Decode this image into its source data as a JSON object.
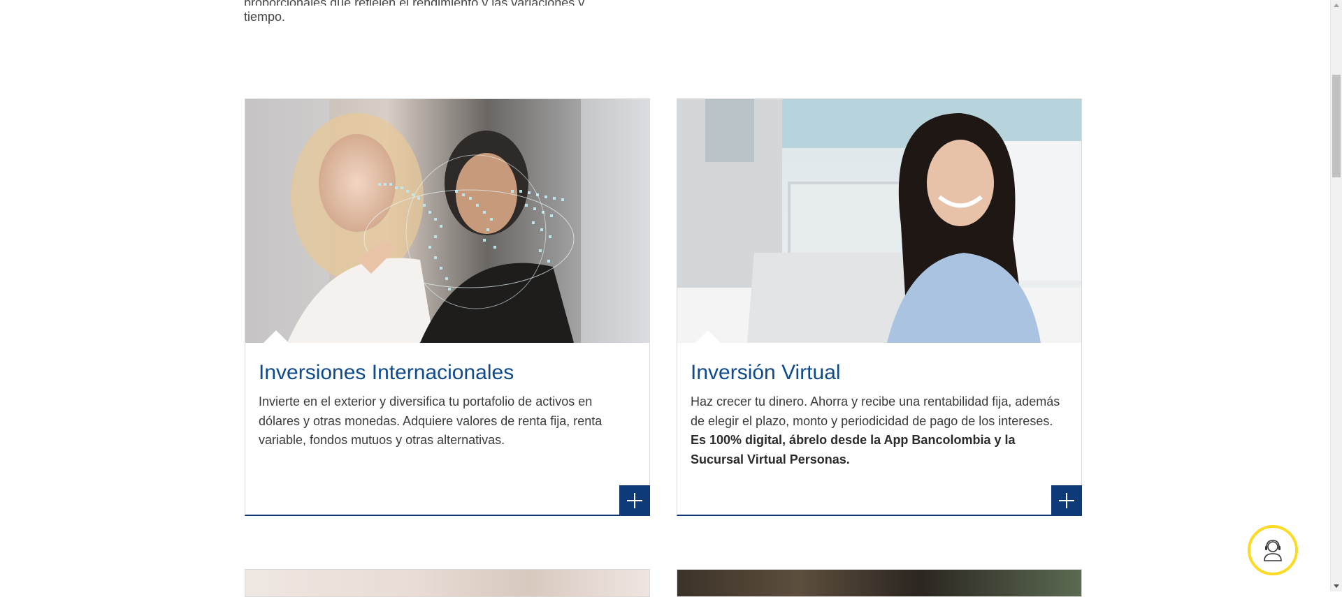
{
  "intro": {
    "cut_line": "proporcionales que reflejen el rendimiento y las variaciones y",
    "tail_word": "tiempo."
  },
  "cards": [
    {
      "title": "Inversiones Internacionales",
      "description": "Invierte en el exterior y diversifica tu portafolio de activos en dólares y otras monedas. Adquiere valores de renta fija, renta variable, fondos mutuos  y otras alternativas.",
      "photo_icon": "world-map-touch-photo",
      "more_icon": "plus-icon"
    },
    {
      "title": "Inversión Virtual",
      "description_plain": "Haz crecer tu dinero. Ahorra y recibe una rentabilidad fija, además de elegir el plazo, monto y periodicidad de pago de los intereses. ",
      "description_bold": "Es 100% digital, ábrelo desde la App Bancolombia y la Sucursal Virtual Personas.",
      "photo_icon": "woman-laptop-photo",
      "more_icon": "plus-icon"
    }
  ],
  "chat": {
    "icon": "support-agent-icon",
    "accent": "#fdda24"
  },
  "colors": {
    "brand_blue": "#0e3a78",
    "title_blue": "#0e4a8c"
  }
}
